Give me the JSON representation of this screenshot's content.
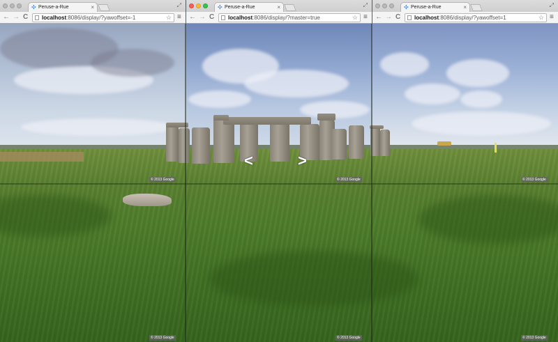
{
  "windows": [
    {
      "tab_title": "Peruse-a-Rue",
      "url_host": "localhost",
      "url_path": ":8086/display/?yawoffset=-1",
      "active": false
    },
    {
      "tab_title": "Peruse-a-Rue",
      "url_host": "localhost",
      "url_path": ":8086/display/?master=true",
      "active": true
    },
    {
      "tab_title": "Peruse-a-Rue",
      "url_host": "localhost",
      "url_path": ":8086/display/?yawoffset=1",
      "active": false
    }
  ],
  "icons": {
    "back": "←",
    "forward": "→",
    "reload": "C",
    "star": "☆",
    "menu": "≡",
    "favicon": "✣",
    "tab_close": "×",
    "resize": "⤢"
  },
  "streetview": {
    "copyright": "© 2013 Google",
    "nav_left": "<",
    "nav_right": ">"
  },
  "colors": {
    "close_light": "#fc5f57",
    "minimize_light": "#fdbc2e",
    "zoom_light": "#34c84a"
  }
}
